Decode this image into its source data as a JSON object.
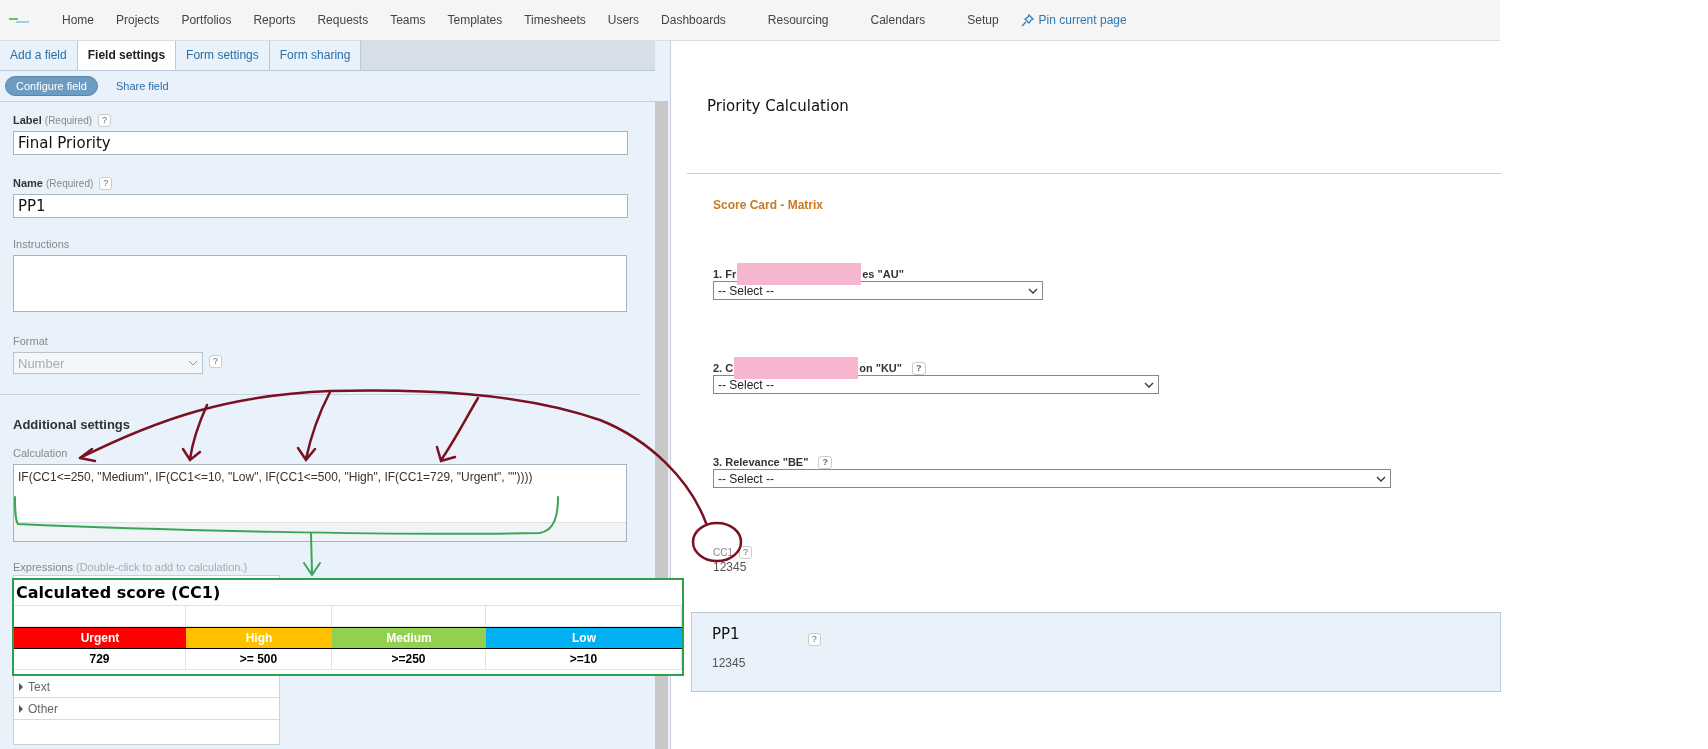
{
  "nav": {
    "items": [
      "Home",
      "Projects",
      "Portfolios",
      "Reports",
      "Requests",
      "Teams",
      "Templates",
      "Timesheets",
      "Users",
      "Dashboards",
      "Resourcing",
      "Calendars",
      "Setup"
    ],
    "pin_link": "Pin current page"
  },
  "tabs": [
    {
      "label": "Add a field",
      "selected": false
    },
    {
      "label": "Field settings",
      "selected": true
    },
    {
      "label": "Form settings",
      "selected": false
    },
    {
      "label": "Form sharing",
      "selected": false
    }
  ],
  "subtabs": [
    {
      "label": "Configure field",
      "selected": true
    },
    {
      "label": "Share field",
      "selected": false
    }
  ],
  "label_field": {
    "label": "Label",
    "hint": "(Required)",
    "help": "?",
    "value": "Final Priority"
  },
  "name_field": {
    "label": "Name",
    "hint": "(Required)",
    "help": "?",
    "value": "PP1"
  },
  "instructions": {
    "label": "Instructions"
  },
  "format": {
    "label": "Format",
    "value": "Number",
    "disabled": true,
    "help": "?"
  },
  "additional_settings": {
    "title": "Additional settings"
  },
  "calculation": {
    "label": "Calculation",
    "value": "IF(CC1<=250, \"Medium\", IF(CC1<=10, \"Low\", IF(CC1<=500, \"High\", IF(CC1=729, \"Urgent\", \"\"))))"
  },
  "expressions": {
    "label": "Expressions",
    "hint": "(Double-click to add to calculation.)",
    "groups": [
      {
        "label": "Text",
        "expanded": false
      },
      {
        "label": "Other",
        "expanded": false
      }
    ]
  },
  "score_table": {
    "title": "Calculated score (CC1)",
    "columns": [
      {
        "label": "Urgent",
        "color": "#ff0000",
        "value": "729"
      },
      {
        "label": "High",
        "color": "#ffc000",
        "value": ">= 500"
      },
      {
        "label": "Medium",
        "color": "#92d050",
        "value": ">=250"
      },
      {
        "label": "Low",
        "color": "#00b0f0",
        "value": ">=10"
      }
    ]
  },
  "form": {
    "title": "Priority Calculation",
    "section": "Score Card - Matrix",
    "questions": [
      {
        "prefix": "1. Fr",
        "suffix": "es \"AU\"",
        "redacted": true,
        "value": "-- Select --"
      },
      {
        "prefix": "2. C",
        "suffix": "on \"KU\"",
        "redacted": true,
        "help": "?",
        "value": "-- Select --"
      },
      {
        "prefix": "3. Relevance \"BE\"",
        "redacted": false,
        "help": "?",
        "value": "-- Select --"
      }
    ],
    "calc_field": {
      "label": "CC1",
      "help": "?",
      "value": "12345"
    },
    "highlighted_field": {
      "label": "PP1",
      "help": "?",
      "value": "12345"
    }
  }
}
